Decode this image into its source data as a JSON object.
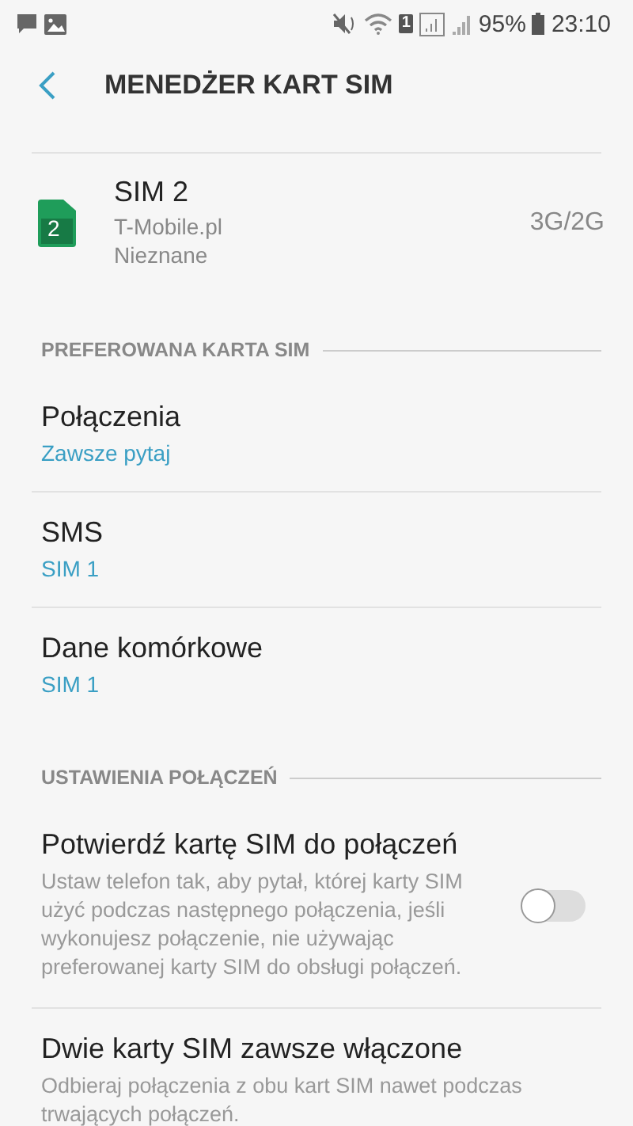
{
  "status_bar": {
    "sim_badge": "1",
    "battery": "95%",
    "time": "23:10"
  },
  "header": {
    "title": "MENEDŻER KART SIM"
  },
  "sim_card": {
    "number": "2",
    "name": "SIM 2",
    "operator": "T-Mobile.pl",
    "status": "Nieznane",
    "network": "3G/2G"
  },
  "sections": [
    {
      "title": "PREFEROWANA KARTA SIM",
      "items": [
        {
          "kind": "value",
          "title": "Połączenia",
          "value": "Zawsze pytaj"
        },
        {
          "kind": "value",
          "title": "SMS",
          "value": "SIM 1"
        },
        {
          "kind": "value",
          "title": "Dane komórkowe",
          "value": "SIM 1"
        }
      ]
    },
    {
      "title": "USTAWIENIA POŁĄCZEŃ",
      "items": [
        {
          "kind": "switch",
          "title": "Potwierdź kartę SIM do połączeń",
          "description": "Ustaw telefon tak, aby pytał, której karty SIM użyć podczas następnego połączenia, jeśli wykonujesz połączenie, nie używając preferowanej karty SIM do obsługi połączeń.",
          "on": false
        },
        {
          "kind": "text",
          "title": "Dwie karty SIM zawsze włączone",
          "description": "Odbieraj połączenia z obu kart SIM nawet podczas trwających połączeń."
        }
      ]
    }
  ]
}
